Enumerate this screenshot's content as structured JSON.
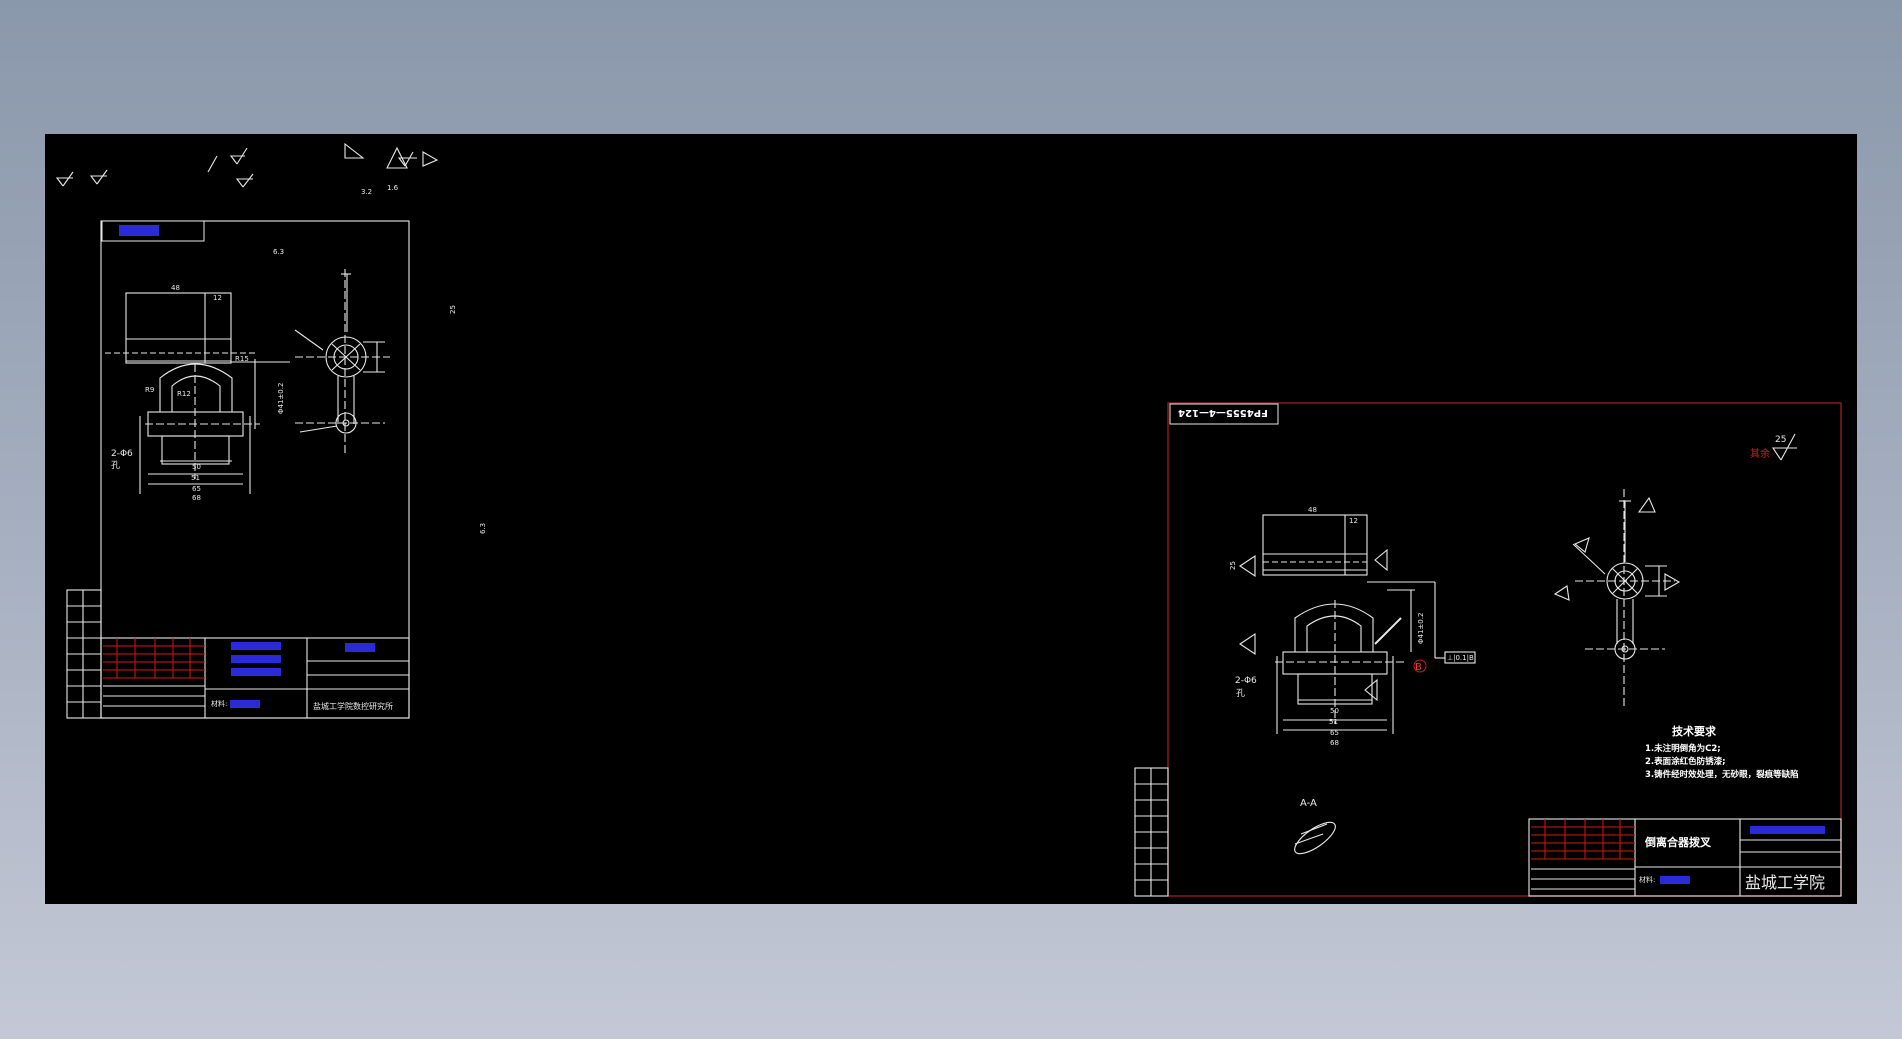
{
  "viewport": {
    "background_top": "#8a98ab",
    "background_bottom": "#c4c8d6",
    "canvas_color": "#000000"
  },
  "symbols": {
    "roughness_3_2": "3.2",
    "roughness_1_6": "1.6",
    "label_25": "25",
    "label_6_3": "6.3"
  },
  "left_sheet": {
    "header_tag": "",
    "roughness": "6.3",
    "dims": {
      "d48": "48",
      "d12": "12",
      "d_r15": "R15",
      "d_r12": "R12",
      "d_r9": "R9",
      "d_phi41": "Φ41±0.2",
      "d50": "50",
      "d65": "65",
      "d68": "68",
      "d51": "51",
      "d_holes": "2-Φ6",
      "d_hole": "孔"
    },
    "title_block": {
      "material": "材料:",
      "company": "盐城工学院数控研究所"
    }
  },
  "right_sheet": {
    "drawing_number": "FP4555—4—124",
    "roughness_value": "25",
    "roughness_note": "其余",
    "section_label": "A-A",
    "view_label": "B",
    "dims": {
      "d48": "48",
      "d12": "12",
      "d25": "25",
      "d50": "50",
      "d65": "65",
      "d68": "68",
      "d51": "51",
      "d_holes": "2-Φ6",
      "d_hole": "孔",
      "d_phi41": "Φ41±0.2",
      "d_tol": "⊥|0.1|B"
    },
    "tech_requirements": {
      "title": "技术要求",
      "items": [
        "1.未注明倒角为C2;",
        "2.表面涂红色防锈漆;",
        "3.铸件经时效处理，无砂眼，裂痕等缺陷"
      ]
    },
    "title_block": {
      "part_name": "倒离合器拨叉",
      "material": "材料:",
      "school": "盐城工学院"
    }
  }
}
